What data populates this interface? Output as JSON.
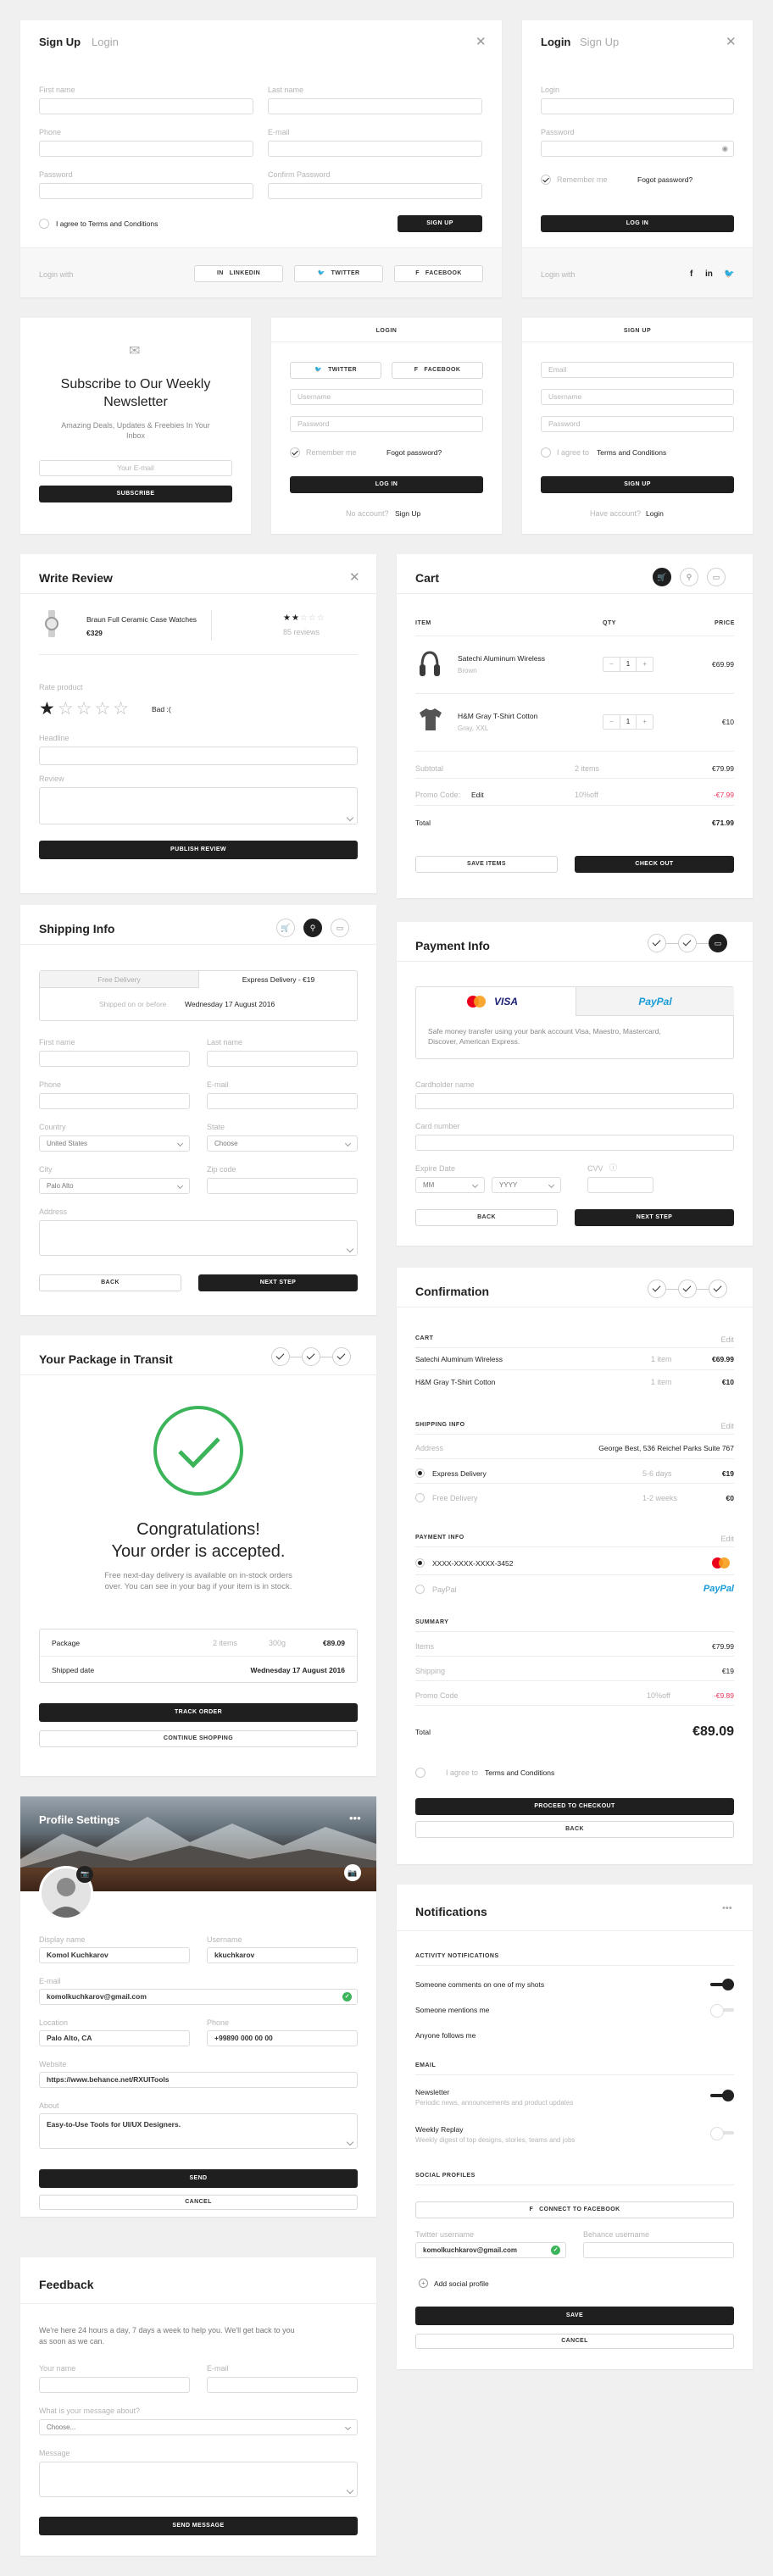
{
  "signup": {
    "tab_active": "Sign Up",
    "tab_other": "Login",
    "first": "First name",
    "last": "Last name",
    "phone": "Phone",
    "email": "E-mail",
    "pass": "Password",
    "confirm": "Confirm Password",
    "terms": "I agree to Terms and Conditions",
    "btn": "SIGN UP",
    "login_with": "Login with",
    "linkedin": "LINKEDIN",
    "twitter": "TWITTER",
    "facebook": "FACEBOOK"
  },
  "login1": {
    "tab_active": "Login",
    "tab_other": "Sign Up",
    "login": "Login",
    "pass": "Password",
    "remember": "Remember me",
    "forgot": "Fogot password?",
    "btn": "LOG IN",
    "login_with": "Login with"
  },
  "newsletter": {
    "title": "Subscribe to Our Weekly Newsletter",
    "sub": "Amazing Deals, Updates & Freebies In Your Inbox",
    "ph": "Your E-mail",
    "btn": "SUBSCRIBE"
  },
  "login2": {
    "header": "LOGIN",
    "twitter": "TWITTER",
    "facebook": "FACEBOOK",
    "user": "Username",
    "pass": "Password",
    "remember": "Remember me",
    "forgot": "Fogot password?",
    "btn": "LOG IN",
    "no_acc": "No account?",
    "signup": "Sign Up"
  },
  "signup2": {
    "header": "SIGN UP",
    "email": "Email",
    "user": "Username",
    "pass": "Password",
    "agree": "I agree to",
    "terms": "Terms and Conditions",
    "btn": "SIGN UP",
    "have": "Have account?",
    "login": "Login"
  },
  "review": {
    "title": "Write Review",
    "product": "Braun Full Ceramic Case Watches",
    "price": "€329",
    "reviews": "85 reviews",
    "rate": "Rate product",
    "rating_text": "Bad :(",
    "headline": "Headline",
    "review": "Review",
    "btn": "PUBLISH REVIEW"
  },
  "cart": {
    "title": "Cart",
    "col_item": "ITEM",
    "col_qty": "QTY",
    "col_price": "PRICE",
    "items": [
      {
        "name": "Satechi Aluminum Wireless",
        "sub": "Brown",
        "qty": "1",
        "price": "€69.99"
      },
      {
        "name": "H&M Gray T-Shirt Cotton",
        "sub": "Gray, XXL",
        "qty": "1",
        "price": "€10"
      }
    ],
    "subtotal": "Subtotal",
    "subtotal_items": "2 items",
    "subtotal_val": "€79.99",
    "promo": "Promo Code:",
    "promo_edit": "Edit",
    "promo_off": "10%off",
    "promo_val": "-€7.99",
    "total": "Total",
    "total_val": "€71.99",
    "save": "SAVE ITEMS",
    "checkout": "CHECK OUT"
  },
  "shipping": {
    "title": "Shipping Info",
    "free": "Free Delivery",
    "express": "Express Delivery - €19",
    "ship_on": "Shipped on or before",
    "ship_date": "Wednesday 17 August 2016",
    "first": "First name",
    "last": "Last name",
    "phone": "Phone",
    "email": "E-mail",
    "country": "Country",
    "state": "State",
    "country_val": "United States",
    "state_val": "Choose",
    "city": "City",
    "zip": "Zip code",
    "city_val": "Palo Alto",
    "address": "Address",
    "back": "BACK",
    "next": "NEXT STEP"
  },
  "payment": {
    "title": "Payment Info",
    "visa": "VISA",
    "paypal": "PayPal",
    "desc": "Safe money transfer using your bank account Visa, Maestro, Mastercard, Discover, American Express.",
    "holder": "Cardholder name",
    "number": "Card number",
    "expire": "Expire Date",
    "cvv": "CVV",
    "mm": "MM",
    "yyyy": "YYYY",
    "back": "BACK",
    "next": "NEXT STEP"
  },
  "transit": {
    "title": "Your Package in Transit",
    "h1": "Congratulations!",
    "h2": "Your order is accepted.",
    "msg": "Free next-day delivery is available on in-stock orders over. You can see in your bag if your item is in stock.",
    "pkg": "Package",
    "pkg_items": "2 items",
    "pkg_w": "300g",
    "pkg_val": "€89.09",
    "shipped": "Shipped date",
    "shipped_val": "Wednesday 17 August 2016",
    "track": "TRACK ORDER",
    "continue": "CONTINUE SHOPPING"
  },
  "confirm": {
    "title": "Confirmation",
    "cart": "CART",
    "edit": "Edit",
    "i1": "Satechi Aluminum Wireless",
    "i1q": "1 item",
    "i1p": "€69.99",
    "i2": "H&M Gray T-Shirt Cotton",
    "i2q": "1 item",
    "i2p": "€10",
    "ship": "SHIPPING INFO",
    "address": "Address",
    "address_val": "George Best, 536 Reichel Parks Suite 767",
    "express": "Express Delivery",
    "express_d": "5-6 days",
    "express_p": "€19",
    "free": "Free Delivery",
    "free_d": "1-2 weeks",
    "free_p": "€0",
    "pay": "PAYMENT INFO",
    "card": "XXXX-XXXX-XXXX-3452",
    "paypal": "PayPal",
    "paypal_logo": "PayPal",
    "summary": "SUMMARY",
    "items": "Items",
    "items_v": "€79.99",
    "shipping": "Shipping",
    "shipping_v": "€19",
    "promo": "Promo Code",
    "promo_off": "10%off",
    "promo_v": "-€9.89",
    "total": "Total",
    "total_v": "€89.09",
    "agree": "I agree to",
    "terms": "Terms and Conditions",
    "proceed": "PROCEED TO CHECKOUT",
    "back": "BACK"
  },
  "profile": {
    "title": "Profile Settings",
    "display": "Display name",
    "display_v": "Komol Kuchkarov",
    "user": "Username",
    "user_v": "kkuchkarov",
    "email": "E-mail",
    "email_v": "komolkuchkarov@gmail.com",
    "location": "Location",
    "location_v": "Palo Alto, CA",
    "phone": "Phone",
    "phone_v": "+99890 000 00 00",
    "website": "Website",
    "website_v": "https://www.behance.net/RXUITools",
    "about": "About",
    "about_v": "Easy-to-Use Tools for UI/UX Designers.",
    "send": "SEND",
    "cancel": "CANCEL"
  },
  "notif": {
    "title": "Notifications",
    "activity": "ACTIVITY NOTIFICATIONS",
    "a1": "Someone comments on one of my shots",
    "a2": "Someone mentions me",
    "a3": "Anyone follows me",
    "email": "EMAIL",
    "n1": "Newsletter",
    "n1s": "Periodic news, announcements and product updates",
    "n2": "Weekly Replay",
    "n2s": "Weekly digest of top designs, stories, teams and jobs",
    "social": "SOCIAL PROFILES",
    "connect": "CONNECT TO FACEBOOK",
    "tw": "Twitter username",
    "tw_v": "komolkuchkarov@gmail.com",
    "be": "Behance username",
    "add": "Add social profile",
    "save": "SAVE",
    "cancel": "CANCEL"
  },
  "feedback": {
    "title": "Feedback",
    "desc": "We're here 24 hours a day, 7 days a week to help you. We'll get back to you as soon as we can.",
    "name": "Your name",
    "email": "E-mail",
    "about": "What is your message about?",
    "choose": "Choose...",
    "msg": "Message",
    "btn": "SEND MESSAGE"
  }
}
